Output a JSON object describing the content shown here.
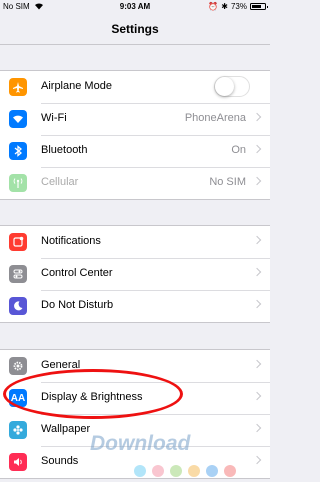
{
  "statusbar": {
    "carrier": "No SIM",
    "time": "9:03 AM",
    "battery": "73%",
    "battery_level": 0.73
  },
  "nav": {
    "title": "Settings"
  },
  "groups": [
    {
      "rows": [
        {
          "label": "Airplane Mode",
          "icon": "airplane-icon",
          "color": "#ff9500",
          "toggle": true
        },
        {
          "label": "Wi-Fi",
          "icon": "wifi-icon",
          "color": "#007aff",
          "value": "PhoneArena"
        },
        {
          "label": "Bluetooth",
          "icon": "bluetooth-icon",
          "color": "#007aff",
          "value": "On"
        },
        {
          "label": "Cellular",
          "icon": "cellular-icon",
          "color": "#a3e2a8",
          "value": "No SIM",
          "dim": true
        }
      ]
    },
    {
      "rows": [
        {
          "label": "Notifications",
          "icon": "notifications-icon",
          "color": "#ff3b30"
        },
        {
          "label": "Control Center",
          "icon": "control-center-icon",
          "color": "#8e8e93"
        },
        {
          "label": "Do Not Disturb",
          "icon": "moon-icon",
          "color": "#5856d6"
        }
      ]
    },
    {
      "rows": [
        {
          "label": "General",
          "icon": "gear-icon",
          "color": "#8e8e93"
        },
        {
          "label": "Display & Brightness",
          "icon": "display-icon",
          "color": "#007aff",
          "glyph": "AA"
        },
        {
          "label": "Wallpaper",
          "icon": "wallpaper-icon",
          "color": "#34aadc"
        },
        {
          "label": "Sounds",
          "icon": "speaker-icon",
          "color": "#ff2d55"
        }
      ]
    }
  ],
  "watermark": "Download",
  "watermark_dots": [
    "#7fd3f5",
    "#f5a0b0",
    "#a8d88a",
    "#f5c16b",
    "#6fb3ef",
    "#f58a8a"
  ]
}
